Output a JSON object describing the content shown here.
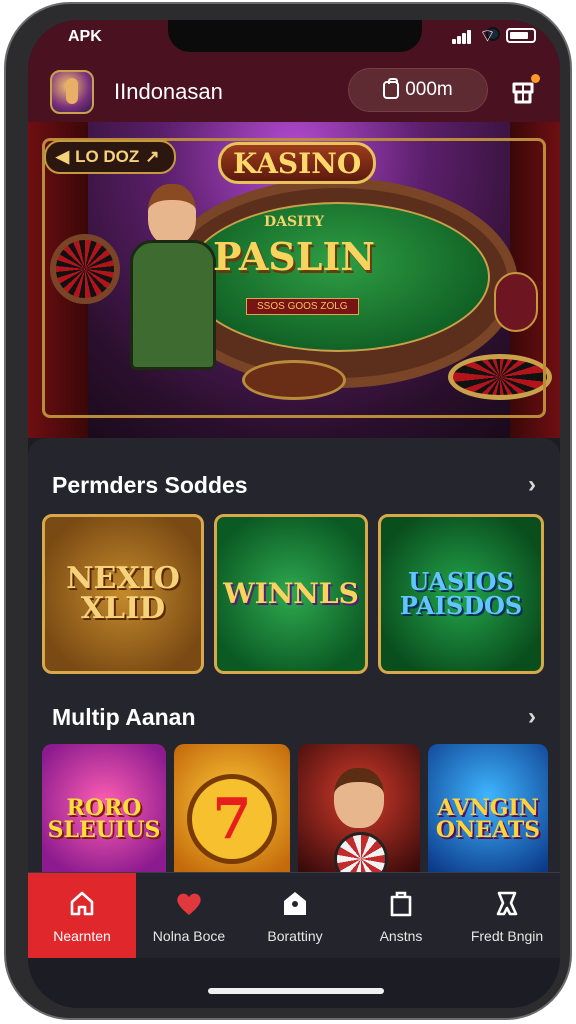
{
  "status_bar": {
    "carrier": "APK"
  },
  "header": {
    "title": "IIndonasan",
    "balance": "000m",
    "avatar_icon": "dealer-avatar-icon",
    "gift_icon": "gift-icon"
  },
  "hero": {
    "badge": "LO DOZ",
    "logo": "KASINO",
    "kicker": "DASITY",
    "title": "PASLIN",
    "subtitle": "SSOS GOOS ZOLG"
  },
  "sections": [
    {
      "title": "Permders Soddes",
      "games": [
        {
          "label": "NEXIO XLID",
          "accent": "#f6d27a"
        },
        {
          "label": "WINNLS",
          "accent": "#f7d45e"
        },
        {
          "label": "UASIOS PAISDOS",
          "accent": "#5fc6ff"
        }
      ]
    },
    {
      "title": "Multip Aanan",
      "games": [
        {
          "label": "RORO SLEUIUS",
          "accent": "#ffde3a"
        },
        {
          "label": "7",
          "accent": "#e81e1e"
        },
        {
          "label": "",
          "accent": "#c12b2b"
        },
        {
          "label": "AVNGIN ONEATS",
          "accent": "#ffd33a"
        }
      ]
    }
  ],
  "nav": [
    {
      "label": "Nearnten",
      "icon": "home-icon",
      "active": true
    },
    {
      "label": "Nolna Boce",
      "icon": "heart-icon",
      "active": false
    },
    {
      "label": "Borattiny",
      "icon": "house-tag-icon",
      "active": false
    },
    {
      "label": "Anstns",
      "icon": "bag-icon",
      "active": false
    },
    {
      "label": "Fredt Bngin",
      "icon": "ribbon-icon",
      "active": false
    }
  ],
  "colors": {
    "header_bg": "#4a1220",
    "content_bg": "#25252d",
    "active_nav": "#e0272c"
  }
}
